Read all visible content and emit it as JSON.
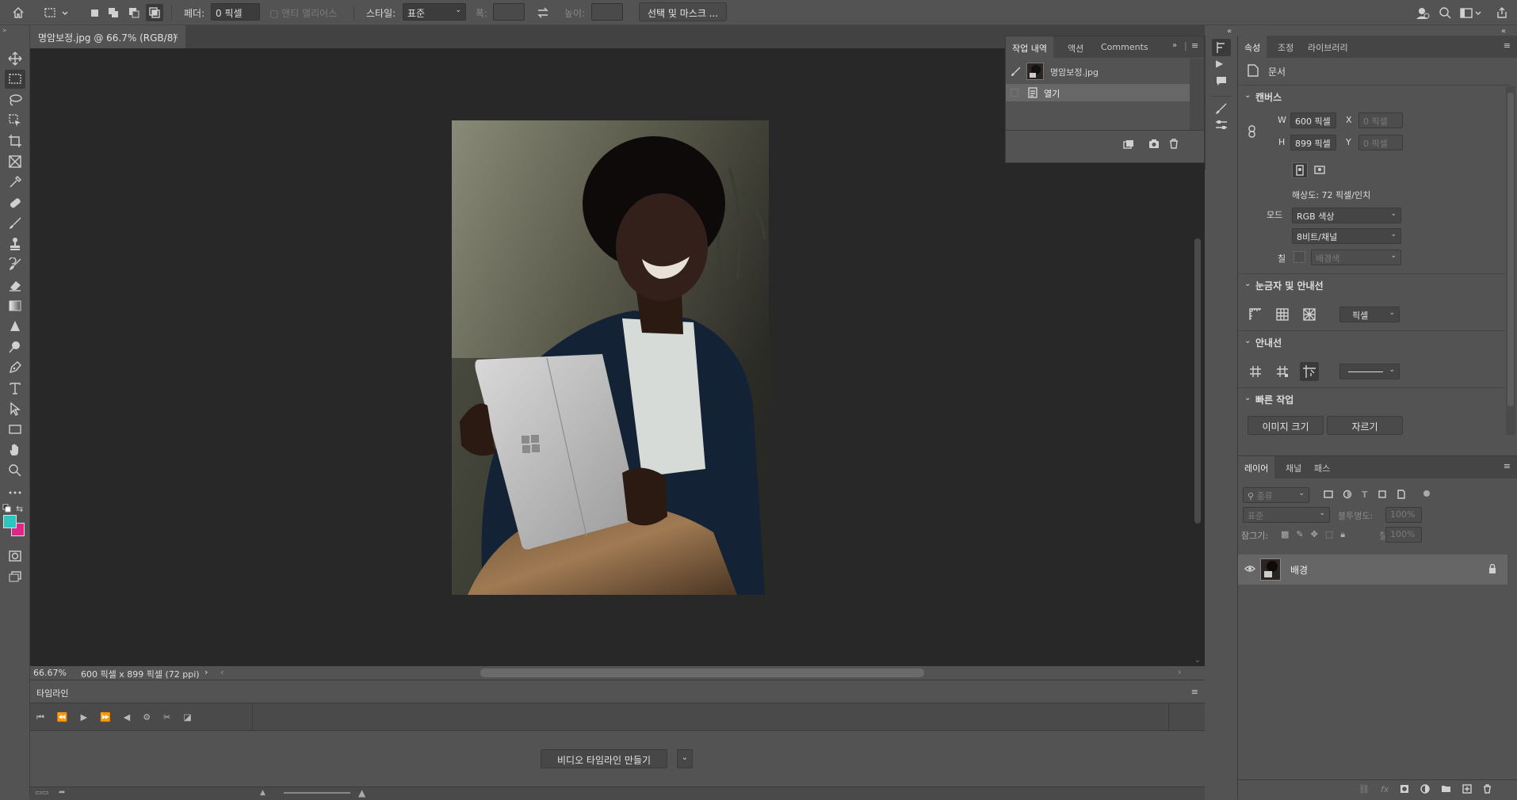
{
  "options_bar": {
    "feather_label": "페더:",
    "feather_value": "0 픽셀",
    "anti_alias_label": "앤티 앨리어스",
    "style_label": "스타일:",
    "style_value": "표준",
    "width_label": "폭:",
    "height_label": "높이:",
    "select_mask_button": "선택 및 마스크 ..."
  },
  "document": {
    "tab_title": "명암보정.jpg @ 66.7% (RGB/8)",
    "tab_close": "×"
  },
  "status_bar": {
    "zoom": "66.67%",
    "doc_info": "600 픽셀 x 899 픽셀 (72 ppi)",
    "arrow": "›"
  },
  "history_panel": {
    "tabs": [
      "작업 내역",
      "액션",
      "Comments"
    ],
    "snapshot_name": "명암보정.jpg",
    "steps": [
      "열기"
    ]
  },
  "properties_panel": {
    "tabs": [
      "속성",
      "조정",
      "라이브러리"
    ],
    "doc_label": "문서",
    "canvas_header": "캔버스",
    "w_label": "W",
    "w_value": "600 픽셀",
    "h_label": "H",
    "h_value": "899 픽셀",
    "x_label": "X",
    "x_value": "0 픽셀",
    "y_label": "Y",
    "y_value": "0 픽셀",
    "resolution": "해상도: 72 픽셀/인치",
    "mode_label": "모드",
    "mode_value": "RGB 색상",
    "bit_value": "8비트/채널",
    "fill_label": "칠",
    "fill_value": "배경색",
    "rulers_header": "눈금자 및 안내선",
    "ruler_unit": "픽셀",
    "guides_header": "안내선",
    "quick_header": "빠른 작업",
    "image_size_button": "이미지 크기",
    "crop_button": "자르기"
  },
  "layers_panel": {
    "tabs": [
      "레이어",
      "채널",
      "패스"
    ],
    "filter_placeholder": "종류",
    "blend_mode": "표준",
    "opacity_label": "불투명도:",
    "opacity_value": "100%",
    "lock_label": "잠그기:",
    "fill_label": "칠:",
    "fill_value": "100%",
    "layers": [
      {
        "name": "배경",
        "visible": true,
        "locked": true
      }
    ]
  },
  "timeline_panel": {
    "tab": "타임라인",
    "create_button": "비디오 타임라인 만들기"
  },
  "colors": {
    "foreground": "#2ec4c0",
    "background": "#e0258a"
  }
}
